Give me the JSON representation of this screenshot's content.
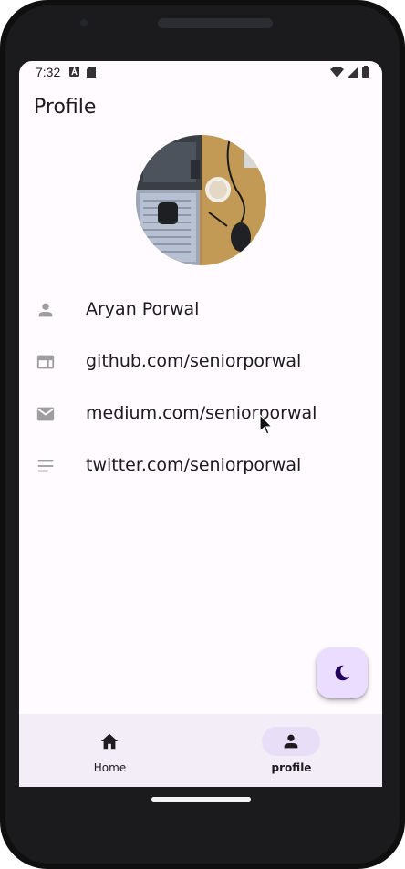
{
  "status_bar": {
    "time": "7:32"
  },
  "app_bar": {
    "title": "Profile"
  },
  "profile": {
    "items": [
      {
        "icon": "person-icon",
        "text": "Aryan Porwal"
      },
      {
        "icon": "web-icon",
        "text": "github.com/seniorporwal"
      },
      {
        "icon": "mail-icon",
        "text": "medium.com/seniorporwal"
      },
      {
        "icon": "notes-icon",
        "text": "twitter.com/seniorporwal"
      }
    ]
  },
  "fab": {
    "icon": "moon-icon"
  },
  "bottom_nav": {
    "items": [
      {
        "icon": "home-icon",
        "label": "Home",
        "selected": false
      },
      {
        "icon": "person-icon",
        "label": "profile",
        "selected": true
      }
    ]
  },
  "colors": {
    "background": "#fffbff",
    "nav_background": "#f3edf7",
    "fab_background": "#eaddff",
    "selected_indicator": "#e8def8",
    "icon_gray": "#9e9e9e",
    "text_primary": "#1c1b1f"
  }
}
